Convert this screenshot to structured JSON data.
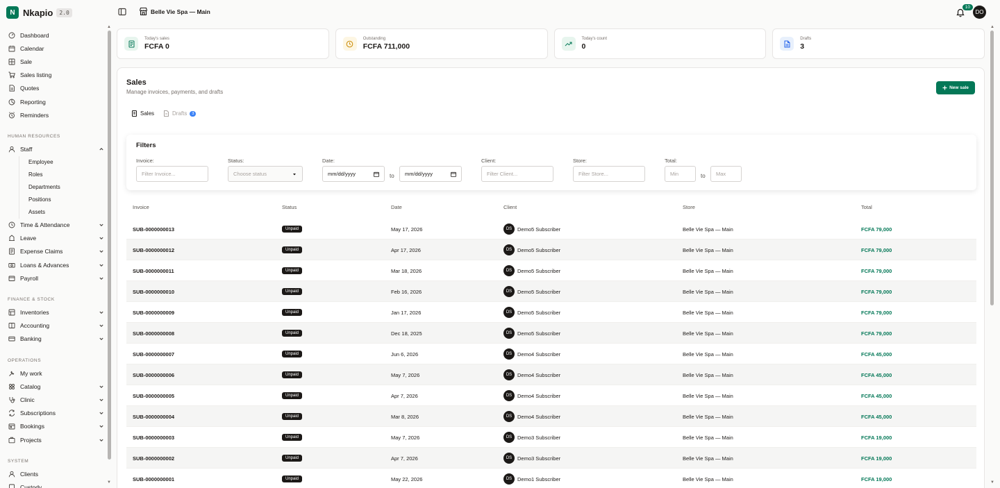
{
  "brand": {
    "name": "Nkapio",
    "version": "2.0"
  },
  "topbar": {
    "store": "Belle Vie Spa — Main",
    "notifications": "10",
    "user_initials": "DO"
  },
  "sidebar": {
    "main": [
      {
        "label": "Dashboard",
        "icon": "dashboard-icon"
      },
      {
        "label": "Calendar",
        "icon": "calendar-icon"
      },
      {
        "label": "Sale",
        "icon": "sale-icon"
      },
      {
        "label": "Sales listing",
        "icon": "cart-icon"
      },
      {
        "label": "Quotes",
        "icon": "quote-icon"
      },
      {
        "label": "Reporting",
        "icon": "reporting-icon"
      },
      {
        "label": "Reminders",
        "icon": "reminder-icon"
      }
    ],
    "hr_label": "HUMAN RESOURCES",
    "staff": {
      "label": "Staff",
      "children": [
        "Employee",
        "Roles",
        "Departments",
        "Positions",
        "Assets"
      ]
    },
    "hr": [
      {
        "label": "Time & Attendance"
      },
      {
        "label": "Leave"
      },
      {
        "label": "Expense Claims"
      },
      {
        "label": "Loans & Advances"
      },
      {
        "label": "Payroll"
      }
    ],
    "finance_label": "FINANCE & STOCK",
    "finance": [
      {
        "label": "Inventories"
      },
      {
        "label": "Accounting"
      },
      {
        "label": "Banking"
      }
    ],
    "operations_label": "OPERATIONS",
    "operations": [
      {
        "label": "My work",
        "chevron": false
      },
      {
        "label": "Catalog",
        "chevron": true
      },
      {
        "label": "Clinic",
        "chevron": true
      },
      {
        "label": "Subscriptions",
        "chevron": true
      },
      {
        "label": "Bookings",
        "chevron": true
      },
      {
        "label": "Projects",
        "chevron": true
      }
    ],
    "system_label": "SYSTEM",
    "system": [
      {
        "label": "Clients"
      },
      {
        "label": "Custody"
      }
    ]
  },
  "stats": [
    {
      "label": "Today's sales",
      "value": "FCFA 0",
      "color": "#047857",
      "bg": "#e7f5ee",
      "icon": "receipt-icon"
    },
    {
      "label": "Outstanding",
      "value": "FCFA 711,000",
      "color": "#ca8a04",
      "bg": "#fdf6e3",
      "icon": "clock-icon"
    },
    {
      "label": "Today's count",
      "value": "0",
      "color": "#047857",
      "bg": "#e7f5ee",
      "icon": "trend-up-icon"
    },
    {
      "label": "Drafts",
      "value": "3",
      "color": "#2563eb",
      "bg": "#e8f0fc",
      "icon": "file-icon"
    }
  ],
  "sales": {
    "title": "Sales",
    "subtitle": "Manage invoices, payments, and drafts",
    "new_button": "New sale",
    "tabs": [
      {
        "label": "Sales"
      },
      {
        "label": "Drafts",
        "badge": "3"
      }
    ]
  },
  "filters": {
    "title": "Filters",
    "invoice_label": "Invoice:",
    "invoice_ph": "Filter Invoice...",
    "status_label": "Status:",
    "status_ph": "Choose status",
    "date_label": "Date:",
    "date_from": "mm/dd/yyyy",
    "date_to": "mm/dd/yyyy",
    "to": "to",
    "client_label": "Client:",
    "client_ph": "Filter Client...",
    "store_label": "Store:",
    "store_ph": "Filter Store...",
    "total_label": "Total:",
    "min_ph": "Min",
    "max_ph": "Max"
  },
  "table": {
    "columns": [
      "Invoice",
      "Status",
      "Date",
      "Client",
      "Store",
      "Total"
    ],
    "rows": [
      {
        "invoice": "SUB-0000000013",
        "status": "Unpaid",
        "date": "May 17, 2026",
        "client_initials": "DS",
        "client": "Demo5 Subscriber",
        "store": "Belle Vie Spa — Main",
        "total": "FCFA 79,000"
      },
      {
        "invoice": "SUB-0000000012",
        "status": "Unpaid",
        "date": "Apr 17, 2026",
        "client_initials": "DS",
        "client": "Demo5 Subscriber",
        "store": "Belle Vie Spa — Main",
        "total": "FCFA 79,000"
      },
      {
        "invoice": "SUB-0000000011",
        "status": "Unpaid",
        "date": "Mar 18, 2026",
        "client_initials": "DS",
        "client": "Demo5 Subscriber",
        "store": "Belle Vie Spa — Main",
        "total": "FCFA 79,000"
      },
      {
        "invoice": "SUB-0000000010",
        "status": "Unpaid",
        "date": "Feb 16, 2026",
        "client_initials": "DS",
        "client": "Demo5 Subscriber",
        "store": "Belle Vie Spa — Main",
        "total": "FCFA 79,000"
      },
      {
        "invoice": "SUB-0000000009",
        "status": "Unpaid",
        "date": "Jan 17, 2026",
        "client_initials": "DS",
        "client": "Demo5 Subscriber",
        "store": "Belle Vie Spa — Main",
        "total": "FCFA 79,000"
      },
      {
        "invoice": "SUB-0000000008",
        "status": "Unpaid",
        "date": "Dec 18, 2025",
        "client_initials": "DS",
        "client": "Demo5 Subscriber",
        "store": "Belle Vie Spa — Main",
        "total": "FCFA 79,000"
      },
      {
        "invoice": "SUB-0000000007",
        "status": "Unpaid",
        "date": "Jun 6, 2026",
        "client_initials": "DS",
        "client": "Demo4 Subscriber",
        "store": "Belle Vie Spa — Main",
        "total": "FCFA 45,000"
      },
      {
        "invoice": "SUB-0000000006",
        "status": "Unpaid",
        "date": "May 7, 2026",
        "client_initials": "DS",
        "client": "Demo4 Subscriber",
        "store": "Belle Vie Spa — Main",
        "total": "FCFA 45,000"
      },
      {
        "invoice": "SUB-0000000005",
        "status": "Unpaid",
        "date": "Apr 7, 2026",
        "client_initials": "DS",
        "client": "Demo4 Subscriber",
        "store": "Belle Vie Spa — Main",
        "total": "FCFA 45,000"
      },
      {
        "invoice": "SUB-0000000004",
        "status": "Unpaid",
        "date": "Mar 8, 2026",
        "client_initials": "DS",
        "client": "Demo4 Subscriber",
        "store": "Belle Vie Spa — Main",
        "total": "FCFA 45,000"
      },
      {
        "invoice": "SUB-0000000003",
        "status": "Unpaid",
        "date": "May 7, 2026",
        "client_initials": "DS",
        "client": "Demo3 Subscriber",
        "store": "Belle Vie Spa — Main",
        "total": "FCFA 19,000"
      },
      {
        "invoice": "SUB-0000000002",
        "status": "Unpaid",
        "date": "Apr 7, 2026",
        "client_initials": "DS",
        "client": "Demo3 Subscriber",
        "store": "Belle Vie Spa — Main",
        "total": "FCFA 19,000"
      },
      {
        "invoice": "SUB-0000000001",
        "status": "Unpaid",
        "date": "May 22, 2026",
        "client_initials": "DS",
        "client": "Demo1 Subscriber",
        "store": "Belle Vie Spa — Main",
        "total": "FCFA 19,000"
      }
    ]
  }
}
